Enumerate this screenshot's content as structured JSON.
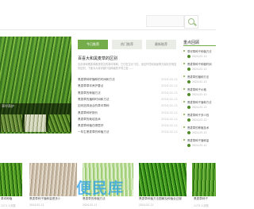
{
  "colors": {
    "accent": "#74ad4a",
    "watermark": "#28a0e6"
  },
  "search": {
    "icon": "search-icon"
  },
  "hero": {
    "caption": "草坪养护",
    "thumbnails": [
      "草坪图片一",
      "草坪图片二",
      "草坪图片三"
    ]
  },
  "tabs": [
    "今日推荐",
    "热门推荐",
    "最新推荐"
  ],
  "featured": {
    "title": "百喜大和黑麦草的区别",
    "summary": "百喜草和黑麦草都是常见的草坪草种，它们在生长习性、适应环境和用途等方面存在明显的区别，下面为大家详细介绍两者的不同之处……"
  },
  "list": [
    {
      "title": "黑麦草种籽播种的时间和方法",
      "date": "2024-02-21"
    },
    {
      "title": "黑麦草草坪养护要点",
      "date": "2024-02-11"
    },
    {
      "title": "黑麦草的种植方法",
      "date": "2024-02-11"
    },
    {
      "title": "黑麦草的播种时间和方法",
      "date": "2024-02-11"
    },
    {
      "title": "如何选择适合的草坪草种",
      "date": "2024-02-11"
    },
    {
      "title": "黑麦草种籽报价",
      "date": "2024-02-11"
    },
    {
      "title": "黑麦草的栽培技术",
      "date": "2024-02-11"
    },
    {
      "title": "黑麦草种植在哪里好",
      "date": "2024-02-11"
    },
    {
      "title": "一年生黑麦草的种植方法",
      "date": "2024-02-11"
    }
  ],
  "sidebar": {
    "title": "重点回顾",
    "items": [
      {
        "title": "草坪草种子种植方法",
        "date": "2024-02-12"
      },
      {
        "title": "黑麦草种子种植时间",
        "date": "2024-02-12"
      },
      {
        "title": "黑麦草的播种方法",
        "date": "2024-02-12"
      },
      {
        "title": "黑麦草种子价格",
        "date": "2024-02-12"
      },
      {
        "title": "黑麦草种子播种方法",
        "date": "2024-02-12"
      },
      {
        "title": "黑麦草种子多少钱",
        "date": "2024-02-12"
      },
      {
        "title": "黑麦草的种植技术",
        "date": "2024-02-12"
      },
      {
        "title": "黑麦草种子播种量",
        "date": "2024-02-12"
      }
    ]
  },
  "cards": [
    {
      "title": "草坪种植",
      "meta": "1171 人浏览"
    },
    {
      "title": "黑麦草种子播种量是多少",
      "meta": "2024-02-11"
    },
    {
      "title": "黑麦草的种植方法",
      "meta": "2024-02-11"
    },
    {
      "title": "黑麦草种植方法图解及种植全过程",
      "meta": "2024-02-11"
    },
    {
      "title": "黑麦草种子",
      "meta": "1173 人浏览"
    }
  ],
  "watermark": "便民库"
}
